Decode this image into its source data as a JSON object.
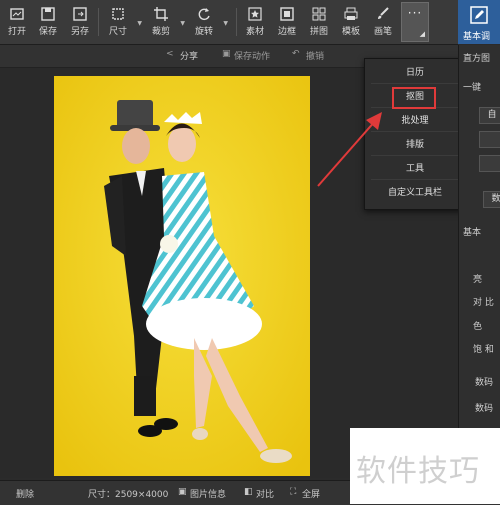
{
  "toolbar": {
    "items": [
      {
        "label": "打开",
        "icon": "open-icon"
      },
      {
        "label": "保存",
        "icon": "save-icon"
      },
      {
        "label": "另存",
        "icon": "save-as-icon"
      },
      {
        "label": "尺寸",
        "icon": "resize-icon"
      },
      {
        "label": "裁剪",
        "icon": "crop-icon"
      },
      {
        "label": "旋转",
        "icon": "rotate-icon"
      },
      {
        "label": "素材",
        "icon": "star-icon"
      },
      {
        "label": "边框",
        "icon": "frame-icon"
      },
      {
        "label": "拼图",
        "icon": "grid-icon"
      },
      {
        "label": "模板",
        "icon": "printer-icon"
      },
      {
        "label": "画笔",
        "icon": "brush-icon"
      }
    ],
    "more_dots": "···"
  },
  "right_header": {
    "label": "基本调",
    "icon": "edit-icon"
  },
  "subbar": {
    "share": "分享",
    "save_action": "保存动作",
    "undo": "撤销"
  },
  "menu": {
    "items": [
      "日历",
      "抠图",
      "批处理",
      "排版",
      "工具",
      "自定义工具栏"
    ],
    "highlighted": "抠图"
  },
  "right_panel": {
    "histogram": "直方图",
    "one_key": "一键",
    "auto": "自",
    "digital": "数",
    "basic": "基本",
    "brightness": "亮",
    "contrast": "对 比",
    "color": "色",
    "saturation": "饱 和",
    "section1": "数码",
    "section2": "数码"
  },
  "bottom": {
    "delete": "删除",
    "size": "尺寸：2509×4000",
    "info": "图片信息",
    "compare": "对比",
    "fullscreen": "全屏"
  },
  "watermark": "软件技巧",
  "colors": {
    "accent": "#2d5f9b",
    "photo_bg": "#f3d21d",
    "highlight": "#e03a3a"
  }
}
